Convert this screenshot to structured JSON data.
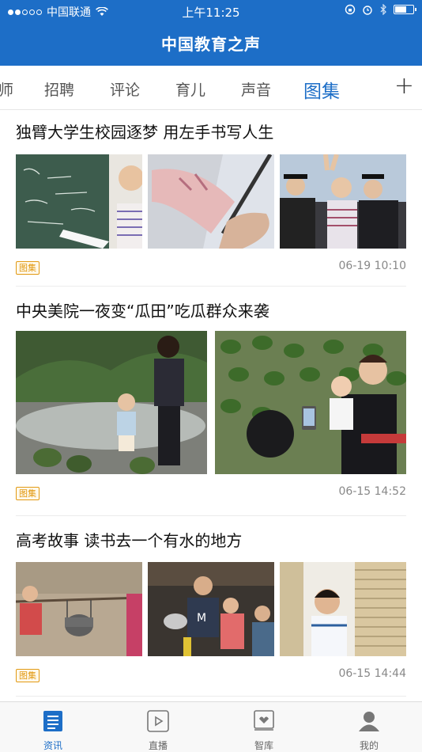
{
  "status": {
    "carrier": "中国联通",
    "time": "上午11:25"
  },
  "header": {
    "title": "中国教育之声"
  },
  "tabs": [
    {
      "label": "师"
    },
    {
      "label": "招聘"
    },
    {
      "label": "评论"
    },
    {
      "label": "育儿"
    },
    {
      "label": "声音"
    },
    {
      "label": "图集",
      "active": true
    }
  ],
  "articles": [
    {
      "title": "独臂大学生校园逐梦 用左手书写人生",
      "tag": "图集",
      "time": "06-19 10:10"
    },
    {
      "title": "中央美院一夜变“瓜田”吃瓜群众来袭",
      "tag": "图集",
      "time": "06-15 14:52"
    },
    {
      "title": "高考故事 读书去一个有水的地方",
      "tag": "图集",
      "time": "06-15 14:44"
    }
  ],
  "tabbar": [
    {
      "label": "资讯",
      "icon": "news-list-icon",
      "active": true
    },
    {
      "label": "直播",
      "icon": "play-icon"
    },
    {
      "label": "智库",
      "icon": "library-icon"
    },
    {
      "label": "我的",
      "icon": "profile-icon"
    }
  ],
  "colors": {
    "brand": "#1d6ec7",
    "tag": "#e29a14"
  }
}
